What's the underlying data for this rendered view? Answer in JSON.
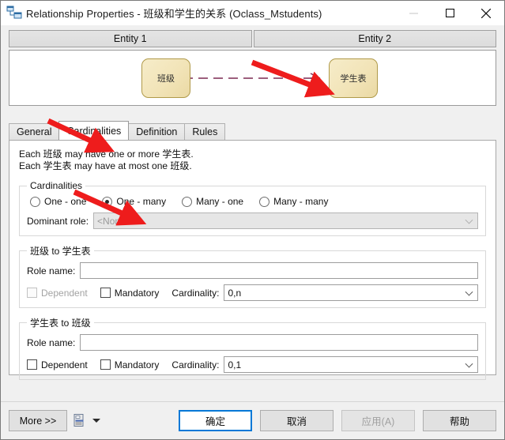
{
  "window": {
    "title": "Relationship Properties - 班级和学生的关系 (Oclass_Mstudents)",
    "icon": "relationship-icon",
    "controls": {
      "minimize": "—",
      "maximize": "☐",
      "close": "✕"
    }
  },
  "entity_header": {
    "entity1_label": "Entity 1",
    "entity2_label": "Entity 2"
  },
  "diagram": {
    "left_entity": "班级",
    "right_entity": "学生表",
    "link_color": "#7d2a52",
    "entity_fill": "#f2e4b8",
    "entity_border": "#b09a4a"
  },
  "tabs": [
    {
      "label": "General",
      "active": false
    },
    {
      "label": "Cardinalities",
      "active": true
    },
    {
      "label": "Definition",
      "active": false
    },
    {
      "label": "Rules",
      "active": false
    }
  ],
  "description": {
    "line1": "Each 班级 may have one or more 学生表.",
    "line2": "Each 学生表 may have at most one 班级."
  },
  "cardinalities_group": {
    "legend": "Cardinalities",
    "options": [
      {
        "label": "One - one",
        "selected": false
      },
      {
        "label": "One - many",
        "selected": true
      },
      {
        "label": "Many - one",
        "selected": false
      },
      {
        "label": "Many - many",
        "selected": false
      }
    ],
    "dominant_role_label": "Dominant role:",
    "dominant_role_value": "<None>",
    "dominant_role_disabled": true
  },
  "role_groups": [
    {
      "legend": "班级 to 学生表",
      "role_name_label": "Role name:",
      "role_name_value": "",
      "dependent_label": "Dependent",
      "dependent_checked": false,
      "dependent_disabled": true,
      "mandatory_label": "Mandatory",
      "mandatory_checked": false,
      "cardinality_label": "Cardinality:",
      "cardinality_value": "0,n"
    },
    {
      "legend": "学生表 to 班级",
      "role_name_label": "Role name:",
      "role_name_value": "",
      "dependent_label": "Dependent",
      "dependent_checked": false,
      "dependent_disabled": false,
      "mandatory_label": "Mandatory",
      "mandatory_checked": false,
      "cardinality_label": "Cardinality:",
      "cardinality_value": "0,1"
    }
  ],
  "buttons": {
    "more": "More >>",
    "print_icon": "report-icon",
    "print_caret": "chevron-down-icon",
    "ok": "确定",
    "cancel": "取消",
    "apply": "应用(A)",
    "apply_disabled": true,
    "help": "帮助"
  },
  "annotations": {
    "color": "#ee1c1c",
    "arrow1_target": "学生表 entity box",
    "arrow2_target": "Cardinalities tab",
    "arrow3_target": "One - many radio"
  }
}
